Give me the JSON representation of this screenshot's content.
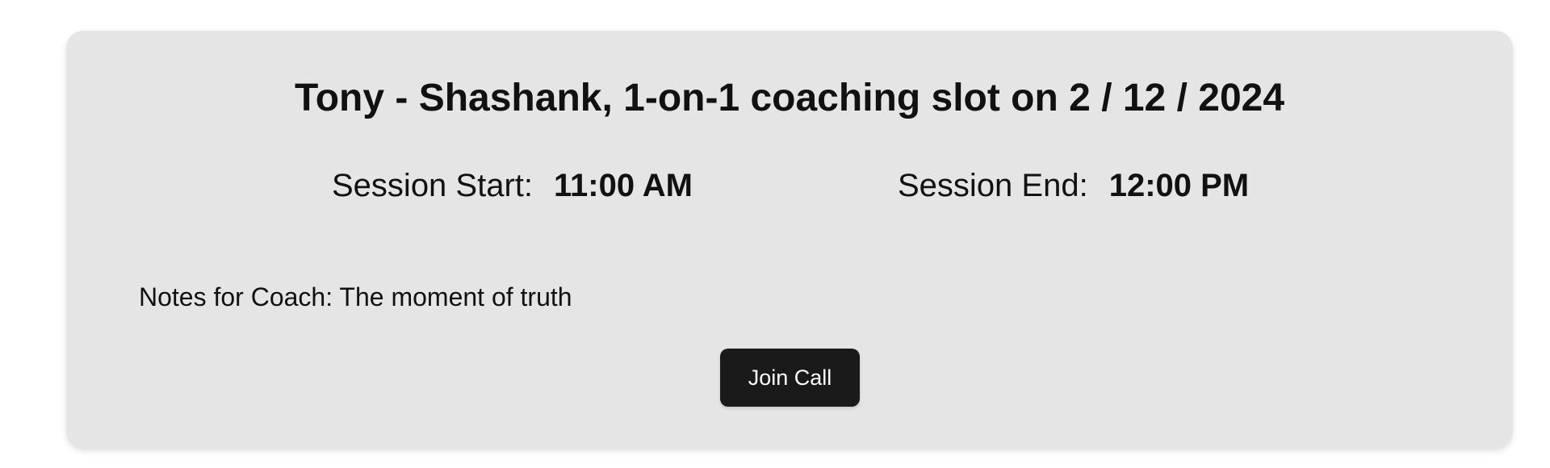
{
  "session": {
    "title": "Tony - Shashank, 1-on-1 coaching slot on 2 / 12 / 2024",
    "start_label": "Session Start:",
    "start_time": "11:00 AM",
    "end_label": "Session End:",
    "end_time": "12:00 PM",
    "notes": "Notes for Coach: The moment of truth",
    "join_label": "Join Call"
  },
  "colors": {
    "card_background": "#e5e5e5",
    "button_background": "#1a1a1a",
    "button_text": "#ffffff",
    "text": "#111111"
  }
}
